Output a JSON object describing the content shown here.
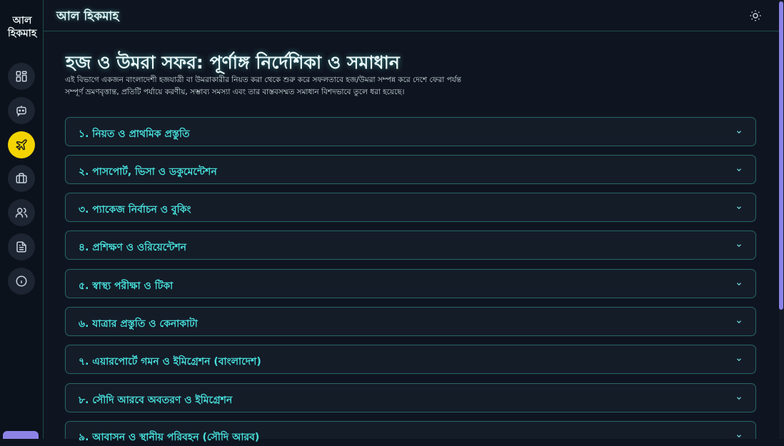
{
  "sidebar": {
    "logo": "আল হিকমাহ",
    "icons": [
      "dashboard-icon",
      "chat-bot-icon",
      "airplane-icon",
      "briefcase-icon",
      "users-icon",
      "document-icon",
      "info-icon"
    ],
    "active_color": "#f3d400"
  },
  "header": {
    "title": "আল হিকমাহ",
    "theme_icon": "sun-icon"
  },
  "main": {
    "title": "হজ ও উমরা সফর: পূর্ণাঙ্গ নির্দেশিকা ও সমাধান",
    "intro_line1": "এই বিভাগে একজন বাংলাদেশী হজযাত্রী বা উমরাকারীর নিয়ত করা থেকে শুরু করে সফলতাবে হজ/উমরা সম্পন্ন করে দেশে ফেরা পর্যন্ত",
    "intro_line2": "সম্পূর্ণ ভ্রমণবৃত্তান্ত, প্রতিটি পর্যায়ে করণীয়, সম্ভাব্য সমস্যা এবং তার বাস্তবসম্মত সমাধান বিশদভাবে তুলে ধরা হয়েছে।",
    "sections": [
      {
        "label": "১. নিয়ত ও প্রাথমিক প্রস্তুতি"
      },
      {
        "label": "২. পাসপোর্ট, ভিসা ও ডকুমেন্টেশন"
      },
      {
        "label": "৩. প্যাকেজ নির্বাচন ও বুকিং"
      },
      {
        "label": "৪. প্রশিক্ষণ ও ওরিয়েন্টেশন"
      },
      {
        "label": "৫. স্বাস্থ্য পরীক্ষা ও টিকা"
      },
      {
        "label": "৬. যাত্রার প্রস্তুতি ও কেনাকাটা"
      },
      {
        "label": "৭. এয়ারপোর্টে গমন ও ইমিগ্রেশন (বাংলাদেশ)"
      },
      {
        "label": "৮. সৌদি আরবে অবতরণ ও ইমিগ্রেশন"
      },
      {
        "label": "৯. আবাসন ও স্থানীয় পরিবহন (সৌদি আরব)"
      }
    ]
  },
  "colors": {
    "accent_text": "#48e0dc",
    "border": "#276565",
    "scroll_thumb": "#8d82e6"
  }
}
